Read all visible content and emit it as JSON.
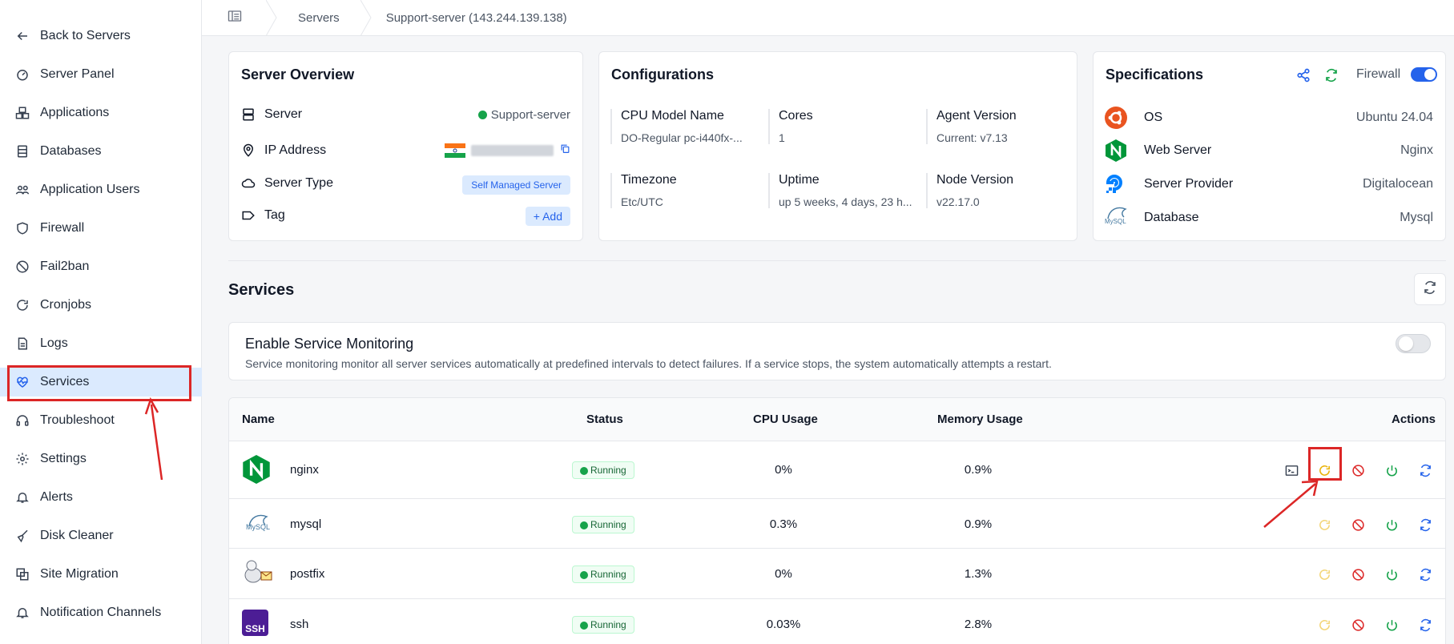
{
  "sidebar": {
    "items": [
      {
        "label": "Back to Servers",
        "icon": "arrow-left-icon"
      },
      {
        "label": "Server Panel",
        "icon": "gauge-icon"
      },
      {
        "label": "Applications",
        "icon": "boxes-icon"
      },
      {
        "label": "Databases",
        "icon": "database-icon"
      },
      {
        "label": "Application Users",
        "icon": "users-icon"
      },
      {
        "label": "Firewall",
        "icon": "shield-icon"
      },
      {
        "label": "Fail2ban",
        "icon": "ban-icon"
      },
      {
        "label": "Cronjobs",
        "icon": "refresh-icon"
      },
      {
        "label": "Logs",
        "icon": "file-icon"
      },
      {
        "label": "Services",
        "icon": "heartbeat-icon"
      },
      {
        "label": "Troubleshoot",
        "icon": "headset-icon"
      },
      {
        "label": "Settings",
        "icon": "gear-icon"
      },
      {
        "label": "Alerts",
        "icon": "bell-icon"
      },
      {
        "label": "Disk Cleaner",
        "icon": "broom-icon"
      },
      {
        "label": "Site Migration",
        "icon": "migrate-icon"
      },
      {
        "label": "Notification Channels",
        "icon": "bell-icon"
      }
    ],
    "active_index": 9
  },
  "breadcrumb": {
    "items": [
      "Servers",
      "Support-server (143.244.139.138)"
    ]
  },
  "overview": {
    "title": "Server Overview",
    "server_label": "Server",
    "server_value": "Support-server",
    "ip_label": "IP Address",
    "server_type_label": "Server Type",
    "server_type_value": "Self Managed Server",
    "tag_label": "Tag",
    "tag_add": "+ Add"
  },
  "configurations": {
    "title": "Configurations",
    "cells": [
      {
        "key": "CPU Model Name",
        "value": "DO-Regular pc-i440fx-..."
      },
      {
        "key": "Cores",
        "value": "1"
      },
      {
        "key": "Agent Version",
        "value": "Current: v7.13"
      },
      {
        "key": "Timezone",
        "value": "Etc/UTC"
      },
      {
        "key": "Uptime",
        "value": "up 5 weeks, 4 days, 23 h..."
      },
      {
        "key": "Node Version",
        "value": "v22.17.0"
      }
    ]
  },
  "specifications": {
    "title": "Specifications",
    "firewall_label": "Firewall",
    "firewall_on": true,
    "rows": [
      {
        "label": "OS",
        "value": "Ubuntu 24.04",
        "icon": "ubuntu-icon"
      },
      {
        "label": "Web Server",
        "value": "Nginx",
        "icon": "nginx-icon"
      },
      {
        "label": "Server Provider",
        "value": "Digitalocean",
        "icon": "digitalocean-icon"
      },
      {
        "label": "Database",
        "value": "Mysql",
        "icon": "mysql-icon"
      }
    ]
  },
  "services": {
    "title": "Services",
    "monitoring": {
      "title": "Enable Service Monitoring",
      "description": "Service monitoring monitor all server services automatically at predefined intervals to detect failures. If a service stops, the system automatically attempts a restart.",
      "enabled": false
    },
    "columns": [
      "Name",
      "Status",
      "CPU Usage",
      "Memory Usage",
      "Actions"
    ],
    "rows": [
      {
        "name": "nginx",
        "status": "Running",
        "cpu": "0%",
        "memory": "0.9%",
        "icon": "nginx-icon"
      },
      {
        "name": "mysql",
        "status": "Running",
        "cpu": "0.3%",
        "memory": "0.9%",
        "icon": "mysql-icon"
      },
      {
        "name": "postfix",
        "status": "Running",
        "cpu": "0%",
        "memory": "1.3%",
        "icon": "postfix-icon"
      },
      {
        "name": "ssh",
        "status": "Running",
        "cpu": "0.03%",
        "memory": "2.8%",
        "icon": "ssh-icon"
      }
    ],
    "ssh_icon_text": "SSH",
    "mysql_icon_text": "MySQL"
  },
  "colors": {
    "accent": "#2563eb",
    "active_bg": "#dbeafe",
    "highlight": "#dc2626",
    "running": "#16a34a",
    "restart": "#eab308",
    "stop": "#dc2626",
    "start": "#16a34a",
    "reload": "#2563eb"
  }
}
